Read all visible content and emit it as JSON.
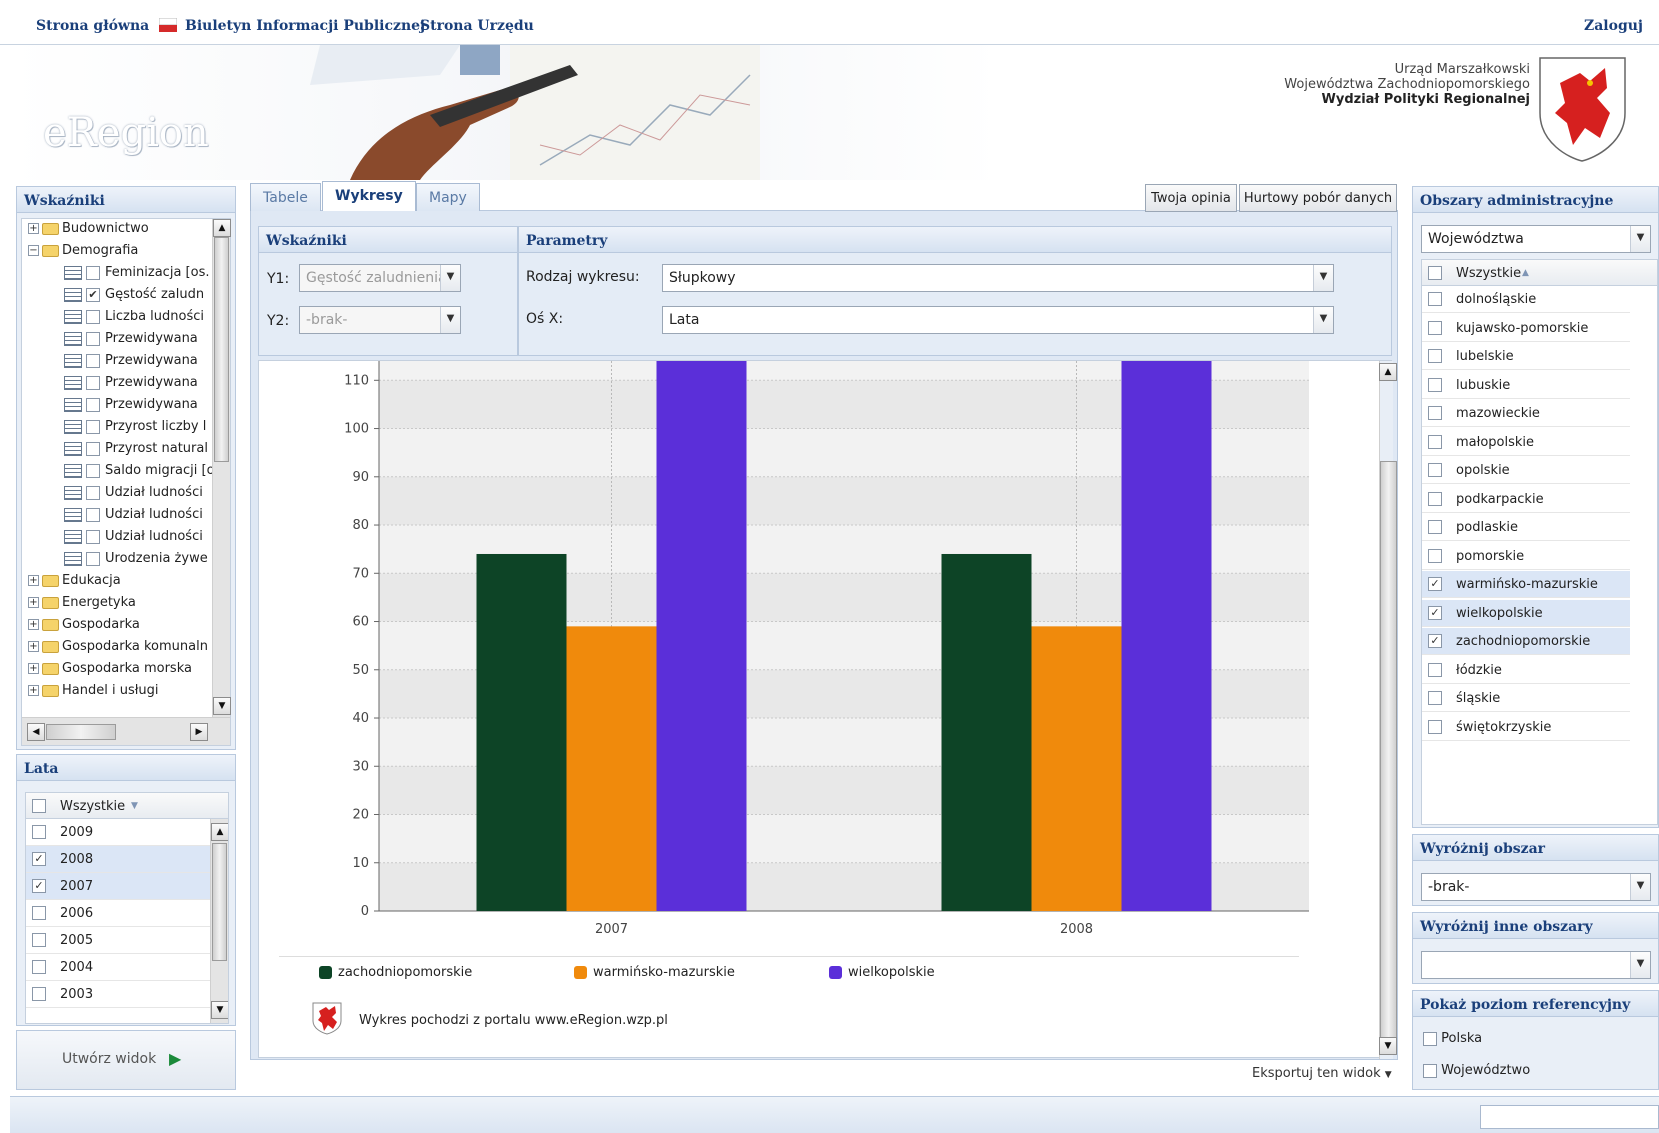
{
  "topnav": {
    "home": "Strona główna",
    "bip": "Biuletyn Informacji Publicznej",
    "office": "Strona Urzędu",
    "login": "Zaloguj"
  },
  "banner": {
    "logo_text": "eRegion",
    "org_line1": "Urząd Marszałkowski",
    "org_line2": "Województwa Zachodniopomorskiego",
    "org_line3": "Wydział Polityki Regionalnej"
  },
  "left": {
    "indicators_title": "Wskaźniki",
    "tree": [
      {
        "label": "Budownictwo",
        "type": "folder",
        "expanded": false
      },
      {
        "label": "Demografia",
        "type": "folder",
        "expanded": true
      },
      {
        "label": "Feminizacja [os.",
        "type": "leaf",
        "checked": false
      },
      {
        "label": "Gęstość zaludn",
        "type": "leaf",
        "checked": true
      },
      {
        "label": "Liczba ludności",
        "type": "leaf",
        "checked": false
      },
      {
        "label": "Przewidywana",
        "type": "leaf",
        "checked": false
      },
      {
        "label": "Przewidywana",
        "type": "leaf",
        "checked": false
      },
      {
        "label": "Przewidywana",
        "type": "leaf",
        "checked": false
      },
      {
        "label": "Przewidywana",
        "type": "leaf",
        "checked": false
      },
      {
        "label": "Przyrost liczby l",
        "type": "leaf",
        "checked": false
      },
      {
        "label": "Przyrost natural",
        "type": "leaf",
        "checked": false
      },
      {
        "label": "Saldo migracji [o",
        "type": "leaf",
        "checked": false
      },
      {
        "label": "Udział ludności",
        "type": "leaf",
        "checked": false
      },
      {
        "label": "Udział ludności",
        "type": "leaf",
        "checked": false
      },
      {
        "label": "Udział ludności",
        "type": "leaf",
        "checked": false
      },
      {
        "label": "Urodzenia żywe",
        "type": "leaf",
        "checked": false
      },
      {
        "label": "Edukacja",
        "type": "folder",
        "expanded": false
      },
      {
        "label": "Energetyka",
        "type": "folder",
        "expanded": false
      },
      {
        "label": "Gospodarka",
        "type": "folder",
        "expanded": false
      },
      {
        "label": "Gospodarka komunaln",
        "type": "folder",
        "expanded": false
      },
      {
        "label": "Gospodarka morska",
        "type": "folder",
        "expanded": false
      },
      {
        "label": "Handel i usługi",
        "type": "folder",
        "expanded": false
      }
    ],
    "years_title": "Lata",
    "years_header": "Wszystkie",
    "years": [
      {
        "label": "2009",
        "checked": false
      },
      {
        "label": "2008",
        "checked": true
      },
      {
        "label": "2007",
        "checked": true
      },
      {
        "label": "2006",
        "checked": false
      },
      {
        "label": "2005",
        "checked": false
      },
      {
        "label": "2004",
        "checked": false
      },
      {
        "label": "2003",
        "checked": false
      }
    ],
    "create_view": "Utwórz widok"
  },
  "center": {
    "tabs": [
      "Tabele",
      "Wykresy",
      "Mapy"
    ],
    "active_tab": "Wykresy",
    "btn_opinion": "Twoja opinia",
    "btn_bulk": "Hurtowy pobór danych",
    "indicators_title": "Wskaźniki",
    "y1_label": "Y1:",
    "y1_value": "Gęstość zaludnienia",
    "y2_label": "Y2:",
    "y2_value": "-brak-",
    "params_title": "Parametry",
    "chart_type_label": "Rodzaj wykresu:",
    "chart_type_value": "Słupkowy",
    "xaxis_label": "Oś X:",
    "xaxis_value": "Lata",
    "source_text": "Wykres pochodzi z portalu www.eRegion.wzp.pl",
    "export": "Eksportuj ten widok"
  },
  "chart_data": {
    "type": "bar",
    "categories": [
      "2007",
      "2008"
    ],
    "series": [
      {
        "name": "zachodniopomorskie",
        "values": [
          74,
          74
        ],
        "color": "#0d4426"
      },
      {
        "name": "warmińsko-mazurskie",
        "values": [
          59,
          59
        ],
        "color": "#f08a0c"
      },
      {
        "name": "wielkopolskie",
        "values": [
          114,
          114
        ],
        "color": "#5b2fd9"
      }
    ],
    "yticks": [
      "0",
      "10",
      "20",
      "30",
      "40",
      "50",
      "60",
      "70",
      "80",
      "90",
      "100",
      "110"
    ],
    "ylim": [
      0,
      114
    ],
    "grid": true,
    "legend_position": "bottom"
  },
  "right": {
    "admin_title": "Obszary administracyjne",
    "admin_level": "Województwa",
    "list_header": "Wszystkie",
    "regions": [
      {
        "label": "dolnośląskie",
        "checked": false
      },
      {
        "label": "kujawsko-pomorskie",
        "checked": false
      },
      {
        "label": "lubelskie",
        "checked": false
      },
      {
        "label": "lubuskie",
        "checked": false
      },
      {
        "label": "mazowieckie",
        "checked": false
      },
      {
        "label": "małopolskie",
        "checked": false
      },
      {
        "label": "opolskie",
        "checked": false
      },
      {
        "label": "podkarpackie",
        "checked": false
      },
      {
        "label": "podlaskie",
        "checked": false
      },
      {
        "label": "pomorskie",
        "checked": false
      },
      {
        "label": "warmińsko-mazurskie",
        "checked": true
      },
      {
        "label": "wielkopolskie",
        "checked": true
      },
      {
        "label": "zachodniopomorskie",
        "checked": true
      },
      {
        "label": "łódzkie",
        "checked": false
      },
      {
        "label": "śląskie",
        "checked": false
      },
      {
        "label": "świętokrzyskie",
        "checked": false
      }
    ],
    "highlight_title": "Wyróżnij obszar",
    "highlight_value": "-brak-",
    "highlight_other_title": "Wyróżnij inne obszary",
    "highlight_other_value": "",
    "ref_title": "Pokaż poziom referencyjny",
    "ref_options": [
      {
        "label": "Polska",
        "checked": false
      },
      {
        "label": "Województwo",
        "checked": false
      }
    ]
  }
}
